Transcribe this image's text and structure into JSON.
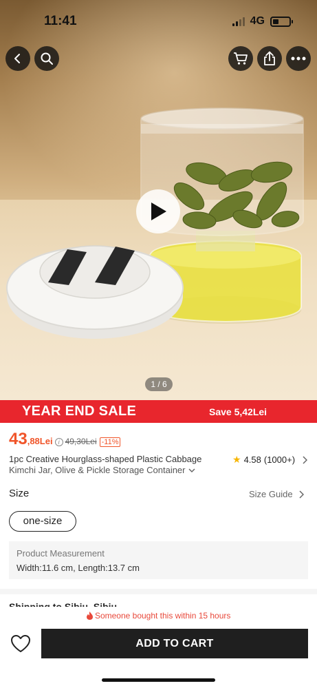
{
  "status_bar": {
    "time": "11:41",
    "network": "4G"
  },
  "toolbar": {
    "back_icon": "chevron-left-icon",
    "search_icon": "search-icon",
    "cart_icon": "cart-icon",
    "share_icon": "share-icon",
    "more_icon": "more-icon"
  },
  "gallery": {
    "page_indicator": "1 / 6",
    "play_icon": "play-icon"
  },
  "sale_banner": {
    "title": "YEAR END SALE",
    "save_text": "Save 5,42Lei",
    "color": "#e8262d"
  },
  "price": {
    "current_int": "43",
    "current_dec": ",88Lei",
    "original": "49,30Lei",
    "discount": "-11%",
    "color": "#f0552a"
  },
  "product": {
    "title_line1": "1pc Creative Hourglass-shaped Plastic Cabbage",
    "title_line2": "Kimchi Jar, Olive & Pickle Storage Container",
    "rating": "4.58",
    "review_count": "(1000+)"
  },
  "size": {
    "label": "Size",
    "guide": "Size Guide",
    "selected": "one-size"
  },
  "measurement": {
    "title": "Product Measurement",
    "width_label": "Width:",
    "width_value": "11.6 cm, ",
    "length_label": "Length:",
    "length_value": "13.7 cm"
  },
  "shipping": {
    "title": "Shipping to Sibiu, Sibiu"
  },
  "bottom_bar": {
    "notice": "Someone bought this within 15 hours",
    "add_to_cart": "ADD TO CART"
  }
}
